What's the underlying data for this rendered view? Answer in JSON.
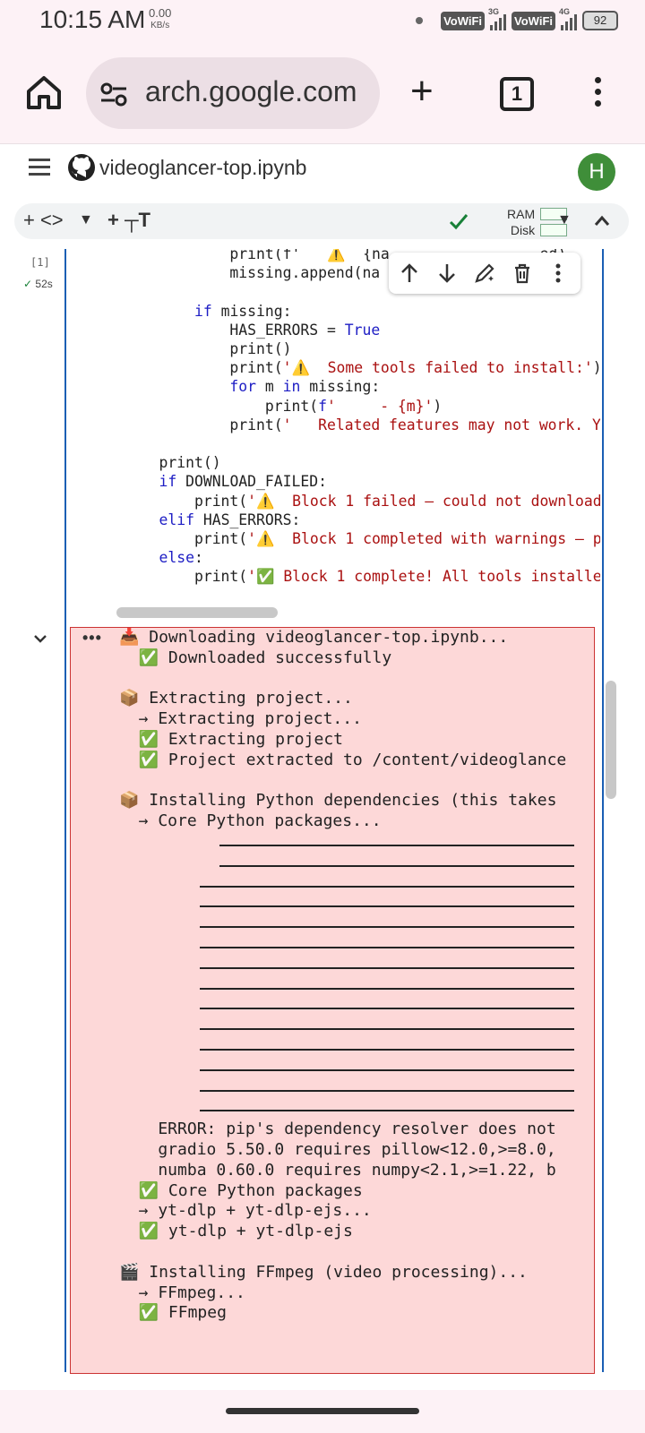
{
  "status_bar": {
    "time": "10:15 AM",
    "net_speed": "0.00",
    "net_unit": "KB/s",
    "sim1_label": "VoWiFi",
    "sim1_signal": "3G",
    "sim2_label": "VoWiFi",
    "sim2_signal": "4G",
    "battery": "92"
  },
  "browser": {
    "url": "arch.google.com",
    "tab_count": "1"
  },
  "notebook": {
    "title": "videoglancer-top.ipynb",
    "avatar_letter": "H"
  },
  "toolbar": {
    "add_code": "+ <>",
    "add_text": "+ ┬T",
    "ram_label": "RAM",
    "disk_label": "Disk"
  },
  "cell": {
    "exec_count": "[1]",
    "exec_time": "52s",
    "code_lines": [
      {
        "indent": "            ",
        "text": "print(f'   ⚠️  {na",
        "tail": "                 ed)"
      },
      {
        "indent": "            ",
        "text": "missing.append(na"
      },
      {
        "indent": "",
        "text": ""
      },
      {
        "indent": "        ",
        "kw": "if",
        "text": " missing:"
      },
      {
        "indent": "            ",
        "text": "HAS_ERRORS = ",
        "blue": "True"
      },
      {
        "indent": "            ",
        "text": "print()"
      },
      {
        "indent": "            ",
        "text": "print(",
        "str": "'⚠️  Some tools failed to install:'",
        "close": ")"
      },
      {
        "indent": "            ",
        "kw": "for",
        "text": " m ",
        "kw2": "in",
        "text2": " missing:"
      },
      {
        "indent": "                ",
        "text": "print(",
        "blue": "f",
        "str": "'     - {m}'",
        "close": ")"
      },
      {
        "indent": "            ",
        "text": "print(",
        "str": "'   Related features may not work. Yo"
      },
      {
        "indent": "",
        "text": ""
      },
      {
        "indent": "    ",
        "text": "print()"
      },
      {
        "indent": "    ",
        "kw": "if",
        "text": " DOWNLOAD_FAILED:"
      },
      {
        "indent": "        ",
        "text": "print(",
        "str": "'⚠️  Block 1 failed — could not download"
      },
      {
        "indent": "    ",
        "kw": "elif",
        "text": " HAS_ERRORS:"
      },
      {
        "indent": "        ",
        "text": "print(",
        "str": "'⚠️  Block 1 completed with warnings — pr"
      },
      {
        "indent": "    ",
        "kw": "else",
        "text": ":"
      },
      {
        "indent": "        ",
        "text": "print(",
        "str": "'✅ Block 1 complete! All tools installed"
      }
    ]
  },
  "output": {
    "lines": [
      "📥 Downloading videoglancer-top.ipynb...",
      "  ✅ Downloaded successfully",
      "",
      "📦 Extracting project...",
      "  → Extracting project...",
      "  ✅ Extracting project",
      "  ✅ Project extracted to /content/videoglance",
      "",
      "📦 Installing Python dependencies (this takes",
      "  → Core Python packages..."
    ],
    "error_lines": [
      "    ERROR: pip's dependency resolver does not",
      "    gradio 5.50.0 requires pillow<12.0,>=8.0,",
      "    numba 0.60.0 requires numpy<2.1,>=1.22, b"
    ],
    "tail_lines": [
      "  ✅ Core Python packages",
      "  → yt-dlp + yt-dlp-ejs...",
      "  ✅ yt-dlp + yt-dlp-ejs",
      "",
      "🎬 Installing FFmpeg (video processing)...",
      "  → FFmpeg...",
      "  ✅ FFmpeg"
    ]
  }
}
